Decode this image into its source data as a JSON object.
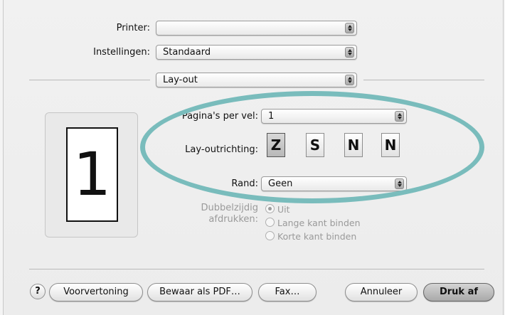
{
  "printer": {
    "label": "Printer:",
    "value": ""
  },
  "settings": {
    "label": "Instellingen:",
    "value": "Standaard"
  },
  "section": {
    "value": "Lay-out"
  },
  "preview": {
    "page_number": "1"
  },
  "pages_per_sheet": {
    "label": "Pagina's per vel:",
    "value": "1"
  },
  "layout_direction": {
    "label": "Lay-outrichting:",
    "options": [
      {
        "name": "z-icon",
        "glyph": "Z",
        "selected": true
      },
      {
        "name": "reverse-z-icon",
        "glyph": "S",
        "selected": false
      },
      {
        "name": "n-icon",
        "glyph": "N",
        "selected": false
      },
      {
        "name": "reverse-n-icon",
        "glyph": "N",
        "selected": false
      }
    ]
  },
  "border": {
    "label": "Rand:",
    "value": "Geen"
  },
  "duplex": {
    "label_line1": "Dubbelzijdig",
    "label_line2": "afdrukken:",
    "options": [
      "Uit",
      "Lange kant binden",
      "Korte kant binden"
    ],
    "selected": 0
  },
  "buttons": {
    "help": "?",
    "preview": "Voorvertoning",
    "save_pdf": "Bewaar als PDF…",
    "fax": "Fax…",
    "cancel": "Annuleer",
    "print": "Druk af"
  },
  "colors": {
    "highlight": "#79bcbc"
  }
}
